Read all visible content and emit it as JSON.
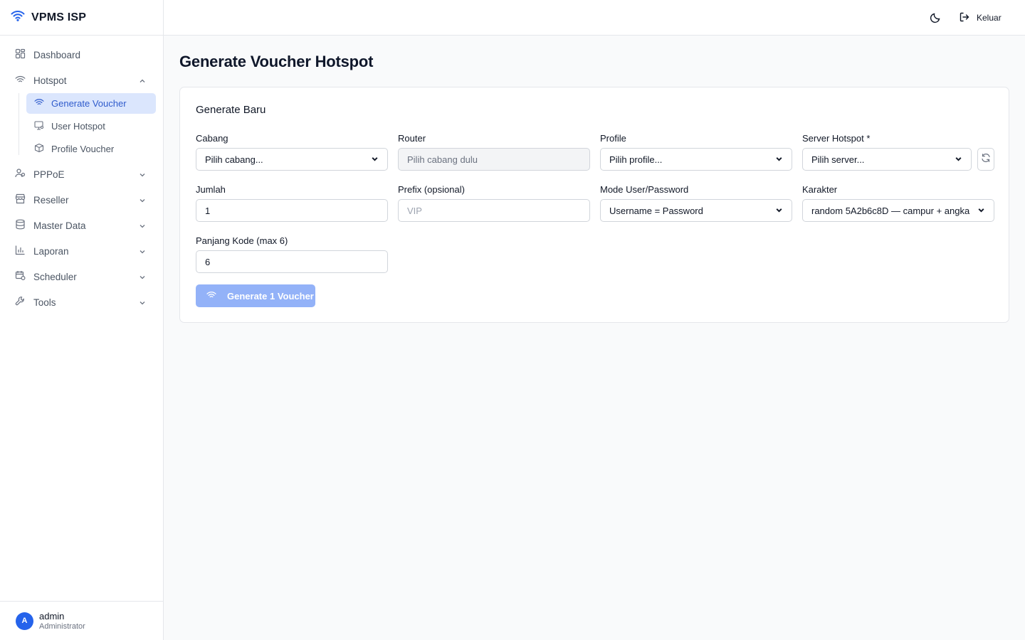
{
  "brand": {
    "title": "VPMS ISP",
    "icon": "wifi-icon"
  },
  "sidebar": {
    "items": [
      {
        "label": "Dashboard",
        "icon": "dashboard-grid-icon"
      },
      {
        "label": "Hotspot",
        "icon": "wifi-icon",
        "expanded": true,
        "children": [
          {
            "label": "Generate Voucher",
            "icon": "wifi-icon",
            "active": true
          },
          {
            "label": "User Hotspot",
            "icon": "monitor-user-icon"
          },
          {
            "label": "Profile Voucher",
            "icon": "package-icon"
          }
        ]
      },
      {
        "label": "PPPoE",
        "icon": "users-icon"
      },
      {
        "label": "Reseller",
        "icon": "store-icon"
      },
      {
        "label": "Master Data",
        "icon": "database-icon"
      },
      {
        "label": "Laporan",
        "icon": "bar-chart-icon"
      },
      {
        "label": "Scheduler",
        "icon": "calendar-icon"
      },
      {
        "label": "Tools",
        "icon": "wrench-icon"
      }
    ]
  },
  "user": {
    "initial": "A",
    "name": "admin",
    "role": "Administrator"
  },
  "topbar": {
    "logout_label": "Keluar",
    "theme_icon": "moon-icon",
    "logout_icon": "logout-icon"
  },
  "page": {
    "title": "Generate Voucher Hotspot"
  },
  "form": {
    "title": "Generate Baru",
    "cabang": {
      "label": "Cabang",
      "value": "Pilih cabang..."
    },
    "router": {
      "label": "Router",
      "value": "Pilih cabang dulu"
    },
    "profile": {
      "label": "Profile",
      "value": "Pilih profile..."
    },
    "server": {
      "label": "Server Hotspot *",
      "value": "Pilih server..."
    },
    "jumlah": {
      "label": "Jumlah",
      "value": "1"
    },
    "prefix": {
      "label": "Prefix (opsional)",
      "placeholder": "VIP"
    },
    "mode": {
      "label": "Mode User/Password",
      "value": "Username = Password"
    },
    "karakter": {
      "label": "Karakter",
      "value": "random 5A2b6c8D — campur + angka"
    },
    "panjang": {
      "label": "Panjang Kode (max 6)",
      "value": "6"
    },
    "submit_label": "Generate 1 Voucher"
  },
  "colors": {
    "accent": "#2563eb",
    "active_bg": "#dbe6fd",
    "button_disabled": "#93b2f8"
  }
}
